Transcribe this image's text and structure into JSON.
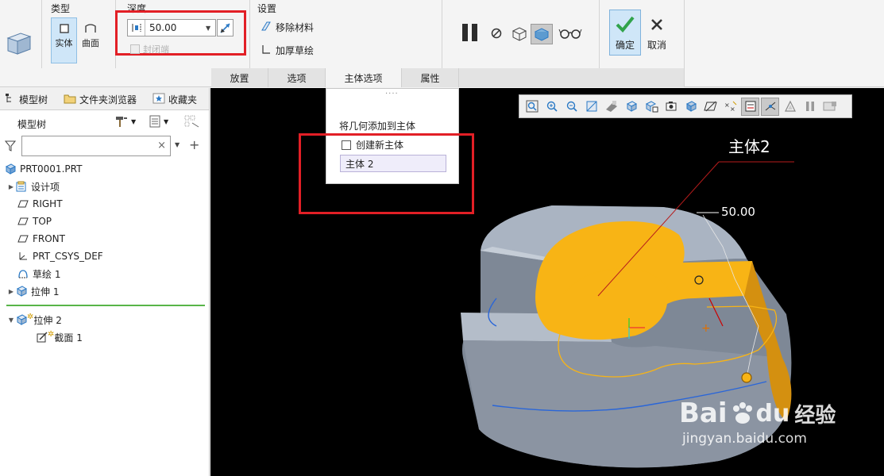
{
  "ribbon": {
    "type_group": {
      "label": "类型",
      "solid": "实体",
      "surface": "曲面"
    },
    "depth_group": {
      "label": "深度",
      "value": "50.00",
      "seal_ends": "封闭端"
    },
    "settings_group": {
      "label": "设置",
      "remove_material": "移除材料",
      "thicken_sketch": "加厚草绘"
    },
    "ok": "确定",
    "cancel": "取消",
    "tabs": [
      "放置",
      "选项",
      "主体选项",
      "属性"
    ]
  },
  "body_options": {
    "title": "将几何添加到主体",
    "create_new_body": "创建新主体",
    "body_value": "主体 2"
  },
  "left_panel": {
    "tabs": [
      "模型树",
      "文件夹浏览器",
      "收藏夹"
    ],
    "tree_label": "模型树",
    "search_placeholder": "",
    "items": [
      {
        "label": "PRT0001.PRT"
      },
      {
        "label": "设计项"
      },
      {
        "label": "RIGHT"
      },
      {
        "label": "TOP"
      },
      {
        "label": "FRONT"
      },
      {
        "label": "PRT_CSYS_DEF"
      },
      {
        "label": "草绘 1"
      },
      {
        "label": "拉伸 1"
      },
      {
        "label": "拉伸 2"
      },
      {
        "label": "截面 1"
      }
    ]
  },
  "viewport": {
    "body_label": "主体2",
    "dimension": "50.00",
    "watermark": {
      "brand": "Bai",
      "du": "du",
      "jingyan": "经验",
      "url": "jingyan.baidu.com"
    }
  },
  "colors": {
    "accent_blue": "#2a79c5",
    "highlight_red": "#e21f26",
    "model_orange": "#f8b415",
    "model_gray": "#9aa4b2"
  }
}
